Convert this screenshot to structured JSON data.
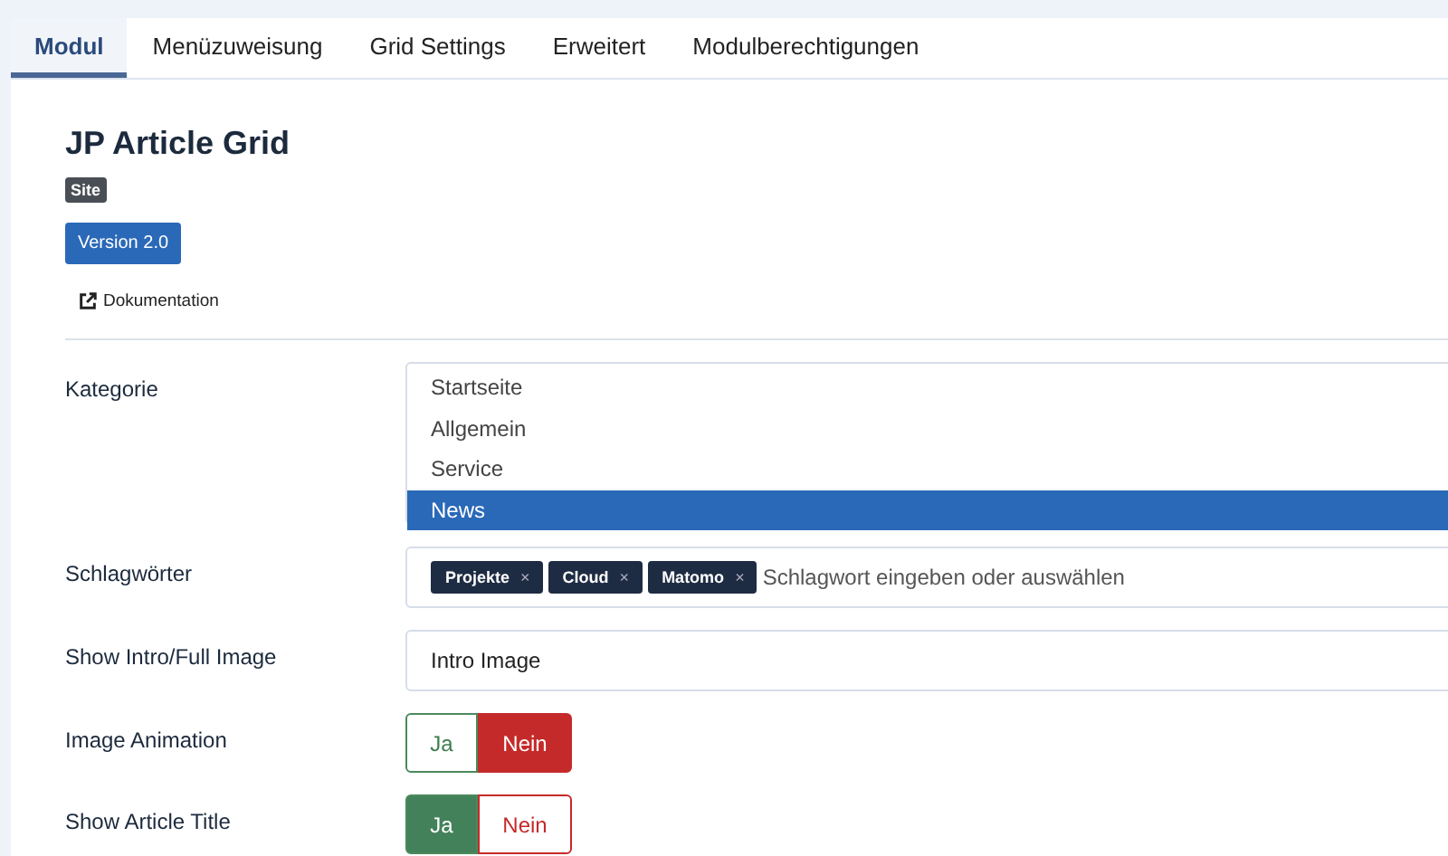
{
  "tabs": [
    {
      "label": "Modul",
      "selected": true
    },
    {
      "label": "Menüzuweisung",
      "selected": false
    },
    {
      "label": "Grid Settings",
      "selected": false
    },
    {
      "label": "Erweitert",
      "selected": false
    },
    {
      "label": "Modulberechtigungen",
      "selected": false
    }
  ],
  "module": {
    "title": "JP Article Grid",
    "badge": "Site",
    "version": "Version 2.0",
    "doc_link": "Dokumentation"
  },
  "fields": [
    {
      "kind": "listbox",
      "label": "Kategorie",
      "options": [
        {
          "label": "Startseite",
          "selected": false
        },
        {
          "label": "Allgemein",
          "selected": false
        },
        {
          "label": "Service",
          "selected": false
        },
        {
          "label": "News",
          "selected": true
        }
      ]
    },
    {
      "kind": "tags",
      "label": "Schlagwörter",
      "tags": [
        {
          "label": "Projekte",
          "remove": "×"
        },
        {
          "label": "Cloud",
          "remove": "×"
        },
        {
          "label": "Matomo",
          "remove": "×"
        }
      ],
      "placeholder": "Schlagwort eingeben oder auswählen"
    },
    {
      "kind": "select",
      "label": "Show Intro/Full Image",
      "value": "Intro Image"
    },
    {
      "kind": "toggle",
      "label": "Image Animation",
      "options": [
        {
          "label": "Ja",
          "kind": "yes",
          "selected": false
        },
        {
          "label": "Nein",
          "kind": "no",
          "selected": true
        }
      ]
    },
    {
      "kind": "toggle",
      "label": "Show Article Title",
      "options": [
        {
          "label": "Ja",
          "kind": "yes",
          "selected": true
        },
        {
          "label": "Nein",
          "kind": "no",
          "selected": false
        }
      ]
    }
  ]
}
